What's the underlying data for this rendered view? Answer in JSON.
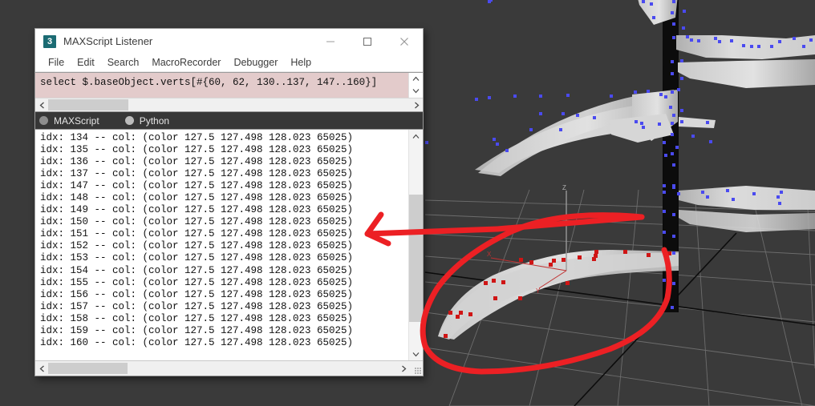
{
  "window": {
    "title": "MAXScript Listener",
    "app_icon_label": "3",
    "controls": {
      "minimize": "minimize-icon",
      "maximize": "maximize-icon",
      "close": "close-icon"
    }
  },
  "menubar": {
    "items": [
      {
        "label": "File"
      },
      {
        "label": "Edit"
      },
      {
        "label": "Search"
      },
      {
        "label": "MacroRecorder"
      },
      {
        "label": "Debugger"
      },
      {
        "label": "Help"
      }
    ]
  },
  "script_input": {
    "value": "select $.baseObject.verts[#{60, 62, 130..137, 147..160}]",
    "placeholder": "",
    "background_color": "#e3cbcb"
  },
  "language_selector": {
    "options": [
      {
        "label": "MAXScript",
        "selected": true
      },
      {
        "label": "Python",
        "selected": false
      }
    ]
  },
  "output_log": {
    "lines": [
      "idx: 134 -- col: (color 127.5 127.498 128.023 65025)",
      "idx: 135 -- col: (color 127.5 127.498 128.023 65025)",
      "idx: 136 -- col: (color 127.5 127.498 128.023 65025)",
      "idx: 137 -- col: (color 127.5 127.498 128.023 65025)",
      "idx: 147 -- col: (color 127.5 127.498 128.023 65025)",
      "idx: 148 -- col: (color 127.5 127.498 128.023 65025)",
      "idx: 149 -- col: (color 127.5 127.498 128.023 65025)",
      "idx: 150 -- col: (color 127.5 127.498 128.023 65025)",
      "idx: 151 -- col: (color 127.5 127.498 128.023 65025)",
      "idx: 152 -- col: (color 127.5 127.498 128.023 65025)",
      "idx: 153 -- col: (color 127.5 127.498 128.023 65025)",
      "idx: 154 -- col: (color 127.5 127.498 128.023 65025)",
      "idx: 155 -- col: (color 127.5 127.498 128.023 65025)",
      "idx: 156 -- col: (color 127.5 127.498 128.023 65025)",
      "idx: 157 -- col: (color 127.5 127.498 128.023 65025)",
      "idx: 158 -- col: (color 127.5 127.498 128.023 65025)",
      "idx: 159 -- col: (color 127.5 127.498 128.023 65025)",
      "idx: 160 -- col: (color 127.5 127.498 128.023 65025)"
    ]
  },
  "viewport": {
    "background_color": "#3a3a3a",
    "grid_color": "#8a8a8a",
    "axis_line_color": "#0a0a0a",
    "mesh_color": "#d4d4d4",
    "trunk_color": "#0b0b0b",
    "unselected_vertex_color": "#4040f0",
    "selected_vertex_color": "#d01818",
    "gizmo": {
      "z_label": "Z",
      "x_label": "X",
      "y_label": "Y",
      "z_axis_color": "#9a9a9a",
      "xy_axis_color": "#c03030"
    }
  },
  "annotation": {
    "stroke_color": "#ec2024",
    "stroke_width": 7,
    "description": "red-hand-drawn-lasso-and-arrow"
  }
}
